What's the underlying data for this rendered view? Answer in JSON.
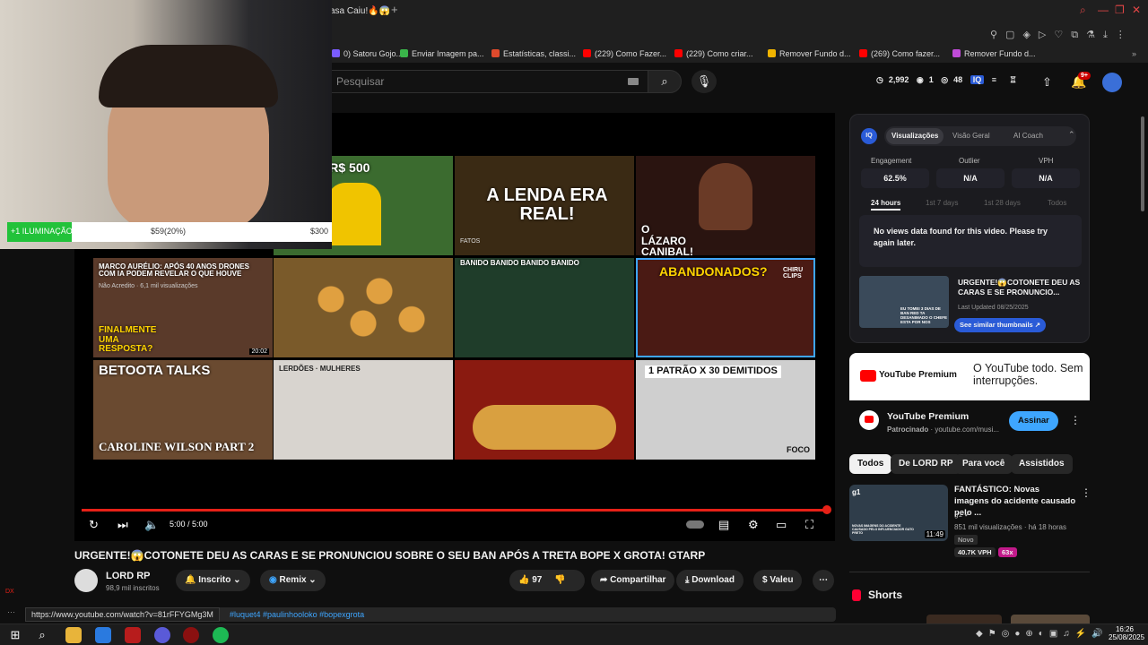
{
  "browser": {
    "tab_title": "asa Caiu!🔥😱",
    "bookmarks": [
      {
        "label": "0) Satoru Gojo...",
        "color": "#7a5cff"
      },
      {
        "label": "Enviar Imagem pa...",
        "color": "#3ab54a"
      },
      {
        "label": "Estatísticas, classi...",
        "color": "#e04a2c"
      },
      {
        "label": "(229) Como Fazer...",
        "color": "#ff0000"
      },
      {
        "label": "(229) Como criar...",
        "color": "#ff0000"
      },
      {
        "label": "Remover Fundo d...",
        "color": "#f0b400"
      },
      {
        "label": "(269) Como fazer...",
        "color": "#ff0000"
      },
      {
        "label": "Remover Fundo d...",
        "color": "#c04bd8"
      }
    ]
  },
  "youtube_header": {
    "search_placeholder": "Pesquisar",
    "stats": {
      "time_value": "2,992",
      "views_value": "1",
      "eye_value": "48"
    },
    "notifications_badge": "9+"
  },
  "overlay": {
    "label": "+1 ILUMINAÇÃO",
    "progress_text": "$59(20%)",
    "goal": "$300",
    "progress_fraction": 0.2
  },
  "player": {
    "time": "5:00 / 5:00",
    "progress_fraction": 1.0,
    "end_screen": [
      {
        "title": "ANDIA - R$ 500",
        "bg": "#3b6b2f"
      },
      {
        "title": "A LENDA ERA REAL!",
        "bg": "#3a2a14"
      },
      {
        "title": "O LÁZARO CANIBAL!",
        "bg": "#2a1410"
      },
      {
        "title": "MARCO AURÉLIO: APÓS 40 ANOS DRONES COM IA PODEM REVELAR O QUE HOUVE",
        "sub": "Não Acredito · 6,1 mil visualizações",
        "tag": "FINALMENTE UMA RESPOSTA?",
        "duration": "20:02",
        "bg": "#5a3a2a"
      },
      {
        "title": "",
        "bg": "#7a5a2a"
      },
      {
        "title": "BANIDO BANIDO BANIDO BANIDO",
        "bg": "#1f3d2a"
      },
      {
        "title": "ABANDONADOS?",
        "sub": "CHIRU CLIPS",
        "bg": "#4a1a14"
      },
      {
        "title": "BETOOTA TALKS",
        "sub": "CAROLINE WILSON PART 2",
        "bg": "#6a4a30"
      },
      {
        "title": "LERDÕES · MULHERES",
        "bg": "#d8d4cf"
      },
      {
        "title": "",
        "bg": "#8a1a10"
      },
      {
        "title": "1 PATRÃO X 30 DEMITIDOS",
        "sub": "FOCO",
        "bg": "#cfcfcf"
      }
    ],
    "url_status": "https://www.youtube.com/watch?v=81rFFYGMg3M"
  },
  "video": {
    "title": "URGENTE!😱COTONETE DEU AS CARAS E SE PRONUNCIOU SOBRE O SEU BAN APÓS A TRETA BOPE X GROTA! GTARP",
    "channel": "LORD RP",
    "subscribers": "98,9 mil inscritos",
    "subscribed_label": "Inscrito",
    "remix_label": "Remix",
    "likes": "97",
    "share_label": "Compartilhar",
    "download_label": "Download",
    "valeu_label": "Valeu",
    "hashtags": "#luquet4 #paulinhooloko #bopexgrota"
  },
  "iq_panel": {
    "tabs": [
      "Visualizações",
      "Visão Geral",
      "AI Coach"
    ],
    "metrics": [
      {
        "label": "Engagement",
        "value": "62.5%"
      },
      {
        "label": "Outlier",
        "value": "N/A"
      },
      {
        "label": "VPH",
        "value": "N/A"
      }
    ],
    "ranges": [
      "24 hours",
      "1st 7 days",
      "1st 28 days",
      "Todos"
    ],
    "no_data": "No views data found for this video. Please try again later.",
    "thumb_title": "URGENTE!😱COTONETE DEU AS CARAS E SE PRONUNCIO...",
    "last_updated": "Last Updated 08/25/2025",
    "similar_btn": "See similar thumbnails ↗",
    "thumb_caption": "EU TOMEI 3 DIAS DE BAN RED TA DESANIMADO O CHEFE ESTA POR NOS"
  },
  "premium": {
    "logo_text": "YouTube Premium",
    "tagline": "O YouTube todo. Sem interrupções.",
    "name": "YouTube Premium",
    "sponsored": "Patrocinado",
    "domain": "youtube.com/musi...",
    "cta": "Assinar"
  },
  "chips": [
    "Todos",
    "De LORD RP",
    "Para você",
    "Assistidos"
  ],
  "recommended": {
    "title": "FANTÁSTICO: Novas imagens do acidente causado pelo ...",
    "channel": "g1",
    "meta": "851 mil visualizações · há 18 horas",
    "badge": "Novo",
    "vph": "40.7K VPH",
    "multiplier": "63x",
    "duration": "11:49",
    "thumb_text": "NOVAS IMAGENS DO ACIDENTE CAUSADO PELO INFLUENCIADOR GATO PRETO"
  },
  "shorts_label": "Shorts",
  "taskbar": {
    "time": "16:26",
    "date": "25/08/2025"
  },
  "colors": {
    "accent_red": "#e62117",
    "blue": "#3ea6ff",
    "bg": "#0f0f0f"
  }
}
